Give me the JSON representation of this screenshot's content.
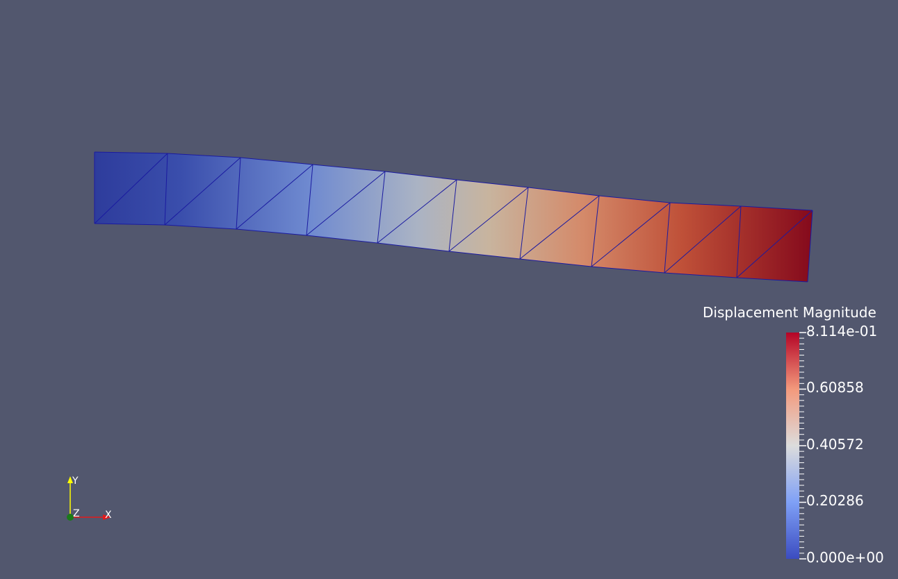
{
  "scalar_bar": {
    "title": "Displacement Magnitude",
    "range": [
      0,
      0.8114
    ],
    "labels": [
      "8.114e-01",
      "0.60858",
      "0.40572",
      "0.20286",
      "0.000e+00"
    ],
    "label_values": [
      0.8114,
      0.60858,
      0.40572,
      0.20286,
      0
    ]
  },
  "colormap": {
    "name": "Cool to Warm",
    "low": "#3b4cc0",
    "mid": "#dddddd",
    "high": "#b40426"
  },
  "mesh": {
    "cells_along_length": 10,
    "triangles_per_cell": 2,
    "edge_color": "#1a1aa0"
  },
  "axes": {
    "x_label": "X",
    "y_label": "Y",
    "z_label": "Z",
    "x_color": "#e31a1c",
    "y_color": "#ffff00",
    "z_color": "#1a7a1a"
  },
  "background_color": "#52576e"
}
